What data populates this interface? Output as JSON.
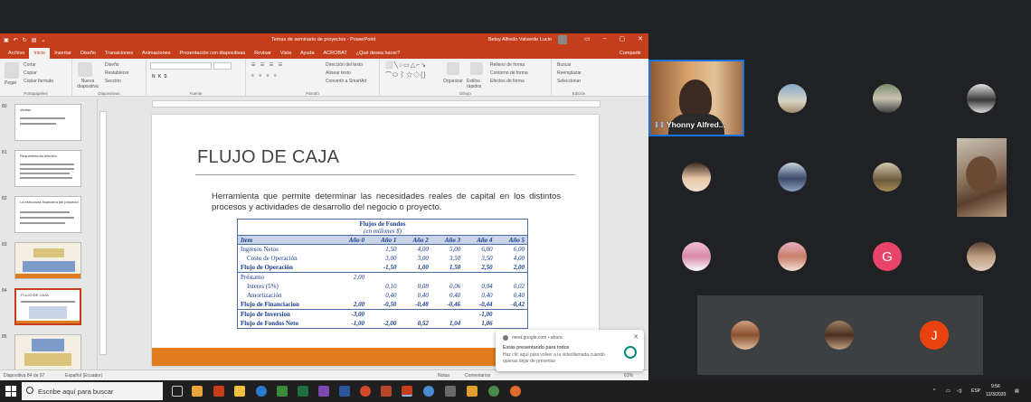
{
  "window": {
    "title": "Temas de seminario de proyectos - PowerPoint",
    "user_name": "Betsy Alfredo Valverde Lucio"
  },
  "menu": {
    "tabs": [
      "Archivo",
      "Inicio",
      "Insertar",
      "Diseño",
      "Transiciones",
      "Animaciones",
      "Presentación con diapositivas",
      "Revisar",
      "Vista",
      "Ayuda",
      "ACROBAT",
      "¿Qué desea hacer?"
    ],
    "share": "Compartir"
  },
  "ribbon": {
    "paste": "Pegar",
    "cut": "Cortar",
    "copy": "Copiar",
    "format_painter": "Copiar formato",
    "clipboard_label": "Portapapeles",
    "new_slide": "Nueva diapositiva",
    "layout": "Diseño",
    "reset": "Restablecer",
    "section": "Sección",
    "slides_label": "Diapositivas",
    "font_label": "Fuente",
    "text_direction": "Dirección del texto",
    "align_text": "Alinear texto",
    "smartart": "Convertir a SmartArt",
    "paragraph_label": "Párrafo",
    "arrange": "Organizar",
    "quick_styles": "Estilos rápidos",
    "shape_fill": "Relleno de forma",
    "shape_outline": "Contorno de forma",
    "shape_effects": "Efectos de forma",
    "drawing_label": "Dibujo",
    "find": "Buscar",
    "replace": "Reemplazar",
    "select": "Seleccionar",
    "editing_label": "Edición"
  },
  "thumbnails": [
    {
      "num": "80",
      "title": "Ventas"
    },
    {
      "num": "81",
      "title": "Requerimiento efectivo"
    },
    {
      "num": "82",
      "title": "La estructura financiera del proyecto"
    },
    {
      "num": "83",
      "title": ""
    },
    {
      "num": "84",
      "title": "FLUJO DE CAJA"
    },
    {
      "num": "85",
      "title": ""
    }
  ],
  "slide": {
    "title": "FLUJO DE CAJA",
    "body": "Herramienta que permite determinar las necesidades reales de capital en los distintos procesos y actividades de desarrollo del negocio o proyecto.",
    "table": {
      "title": "Flujos de Fondos",
      "subtitle": "(en millones $)",
      "headers": [
        "Item",
        "Año 0",
        "Año 1",
        "Año 2",
        "Año 3",
        "Año 4",
        "Año 5"
      ],
      "rows": [
        {
          "cells": [
            "Ingresos Netos",
            "",
            "1,50",
            "4,00",
            "5,00",
            "6,00",
            "6,00"
          ],
          "style": "normal"
        },
        {
          "cells": [
            "Costo de Operación",
            "",
            "3,00",
            "3,00",
            "3,50",
            "3,50",
            "4,00"
          ],
          "style": "indent"
        },
        {
          "cells": [
            "Flujo de Operación",
            "",
            "-1,50",
            "1,00",
            "1,50",
            "2,50",
            "2,00"
          ],
          "style": "bold"
        },
        {
          "cells": [
            "Préstamo",
            "2,00",
            "",
            "",
            "",
            "",
            ""
          ],
          "style": "normal"
        },
        {
          "cells": [
            "Interes (5%)",
            "",
            "0,10",
            "0,08",
            "0,06",
            "0,04",
            "0,02"
          ],
          "style": "indent"
        },
        {
          "cells": [
            "Amortización",
            "",
            "0,40",
            "0,40",
            "0,40",
            "0,40",
            "0,40"
          ],
          "style": "indent"
        },
        {
          "cells": [
            "Flujo de Financiacion",
            "2,00",
            "-0,50",
            "-0,48",
            "-0,46",
            "-0,44",
            "-0,42"
          ],
          "style": "bold"
        },
        {
          "cells": [
            "Flujo de Inversion",
            "-3,00",
            "",
            "",
            "",
            "-1,00",
            ""
          ],
          "style": "bold"
        },
        {
          "cells": [
            "Flujo de Fondos Neto",
            "-1,00",
            "-2,00",
            "0,52",
            "1,04",
            "1,06",
            ""
          ],
          "style": "bold"
        }
      ]
    }
  },
  "status": {
    "slide_count": "Diapositiva 84 de 97",
    "language": "Español (Ecuador)",
    "notes": "Notas",
    "comments": "Comentarios",
    "zoom": "61%"
  },
  "notification": {
    "site": "meet.google.com • ahora",
    "message": "Estás presentando para todos",
    "detail": "Haz clic aquí para volver a la videollamada cuando quieras dejar de presentar"
  },
  "meet": {
    "active_speaker": "Yhonny Alfred...",
    "avatar_g": "G",
    "avatar_j": "J"
  },
  "taskbar": {
    "search_placeholder": "Escribe aquí para buscar",
    "language": "ESP",
    "time": "9:56",
    "date": "12/3/2020"
  }
}
